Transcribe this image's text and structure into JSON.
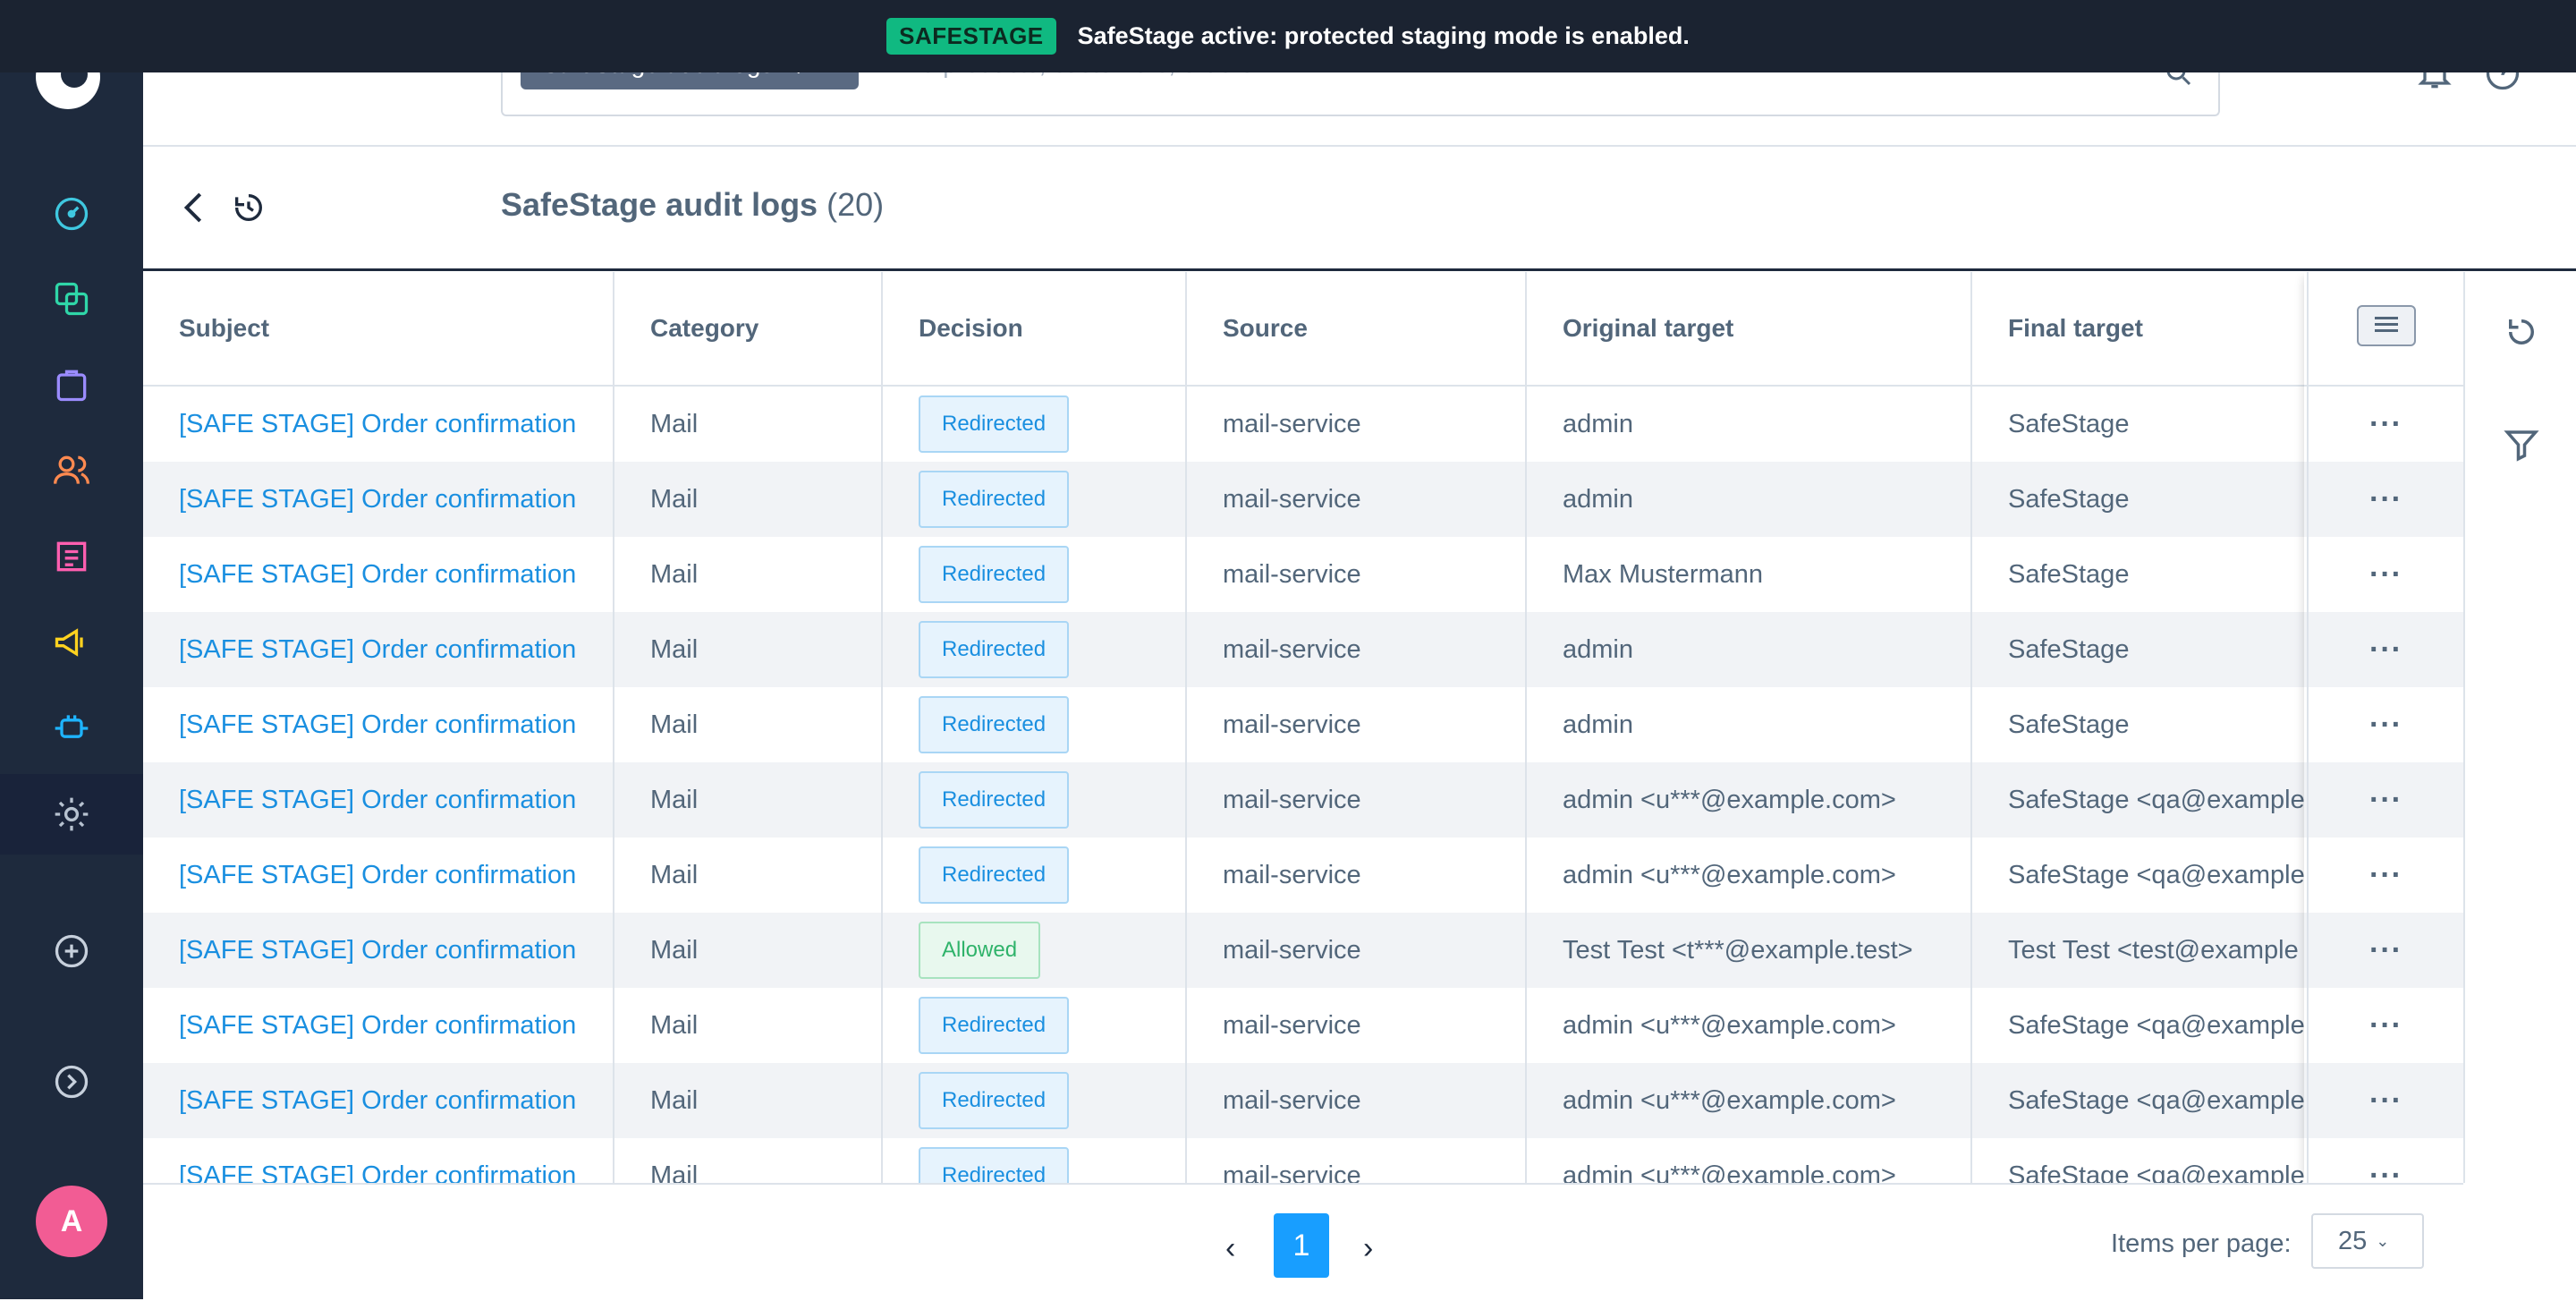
{
  "banner": {
    "badge": "SAFESTAGE",
    "message": "SafeStage active: protected staging mode is enabled."
  },
  "header": {
    "search_type": "SafeStage audit logs",
    "search_placeholder": "Find products, customers, orders..."
  },
  "sidebar": {
    "avatar_initial": "A",
    "icons": [
      "dashboard-icon",
      "catalog-icon",
      "orders-icon",
      "customers-icon",
      "content-icon",
      "marketing-icon",
      "extensions-icon",
      "settings-icon",
      "add-icon",
      "expand-icon"
    ],
    "colors": {
      "dashboard": "#3fc8e0",
      "catalog": "#2fd6a8",
      "orders": "#9b8cff",
      "customers": "#ff8a50",
      "content": "#ff5fb0",
      "marketing": "#ffd21f",
      "extensions": "#1eb4ff",
      "settings": "#b7c2d0"
    }
  },
  "page": {
    "title": "SafeStage audit logs",
    "count": "(20)"
  },
  "table": {
    "columns": [
      "Subject",
      "Category",
      "Decision",
      "Source",
      "Original target",
      "Final target"
    ],
    "rows": [
      {
        "subject": "[SAFE STAGE] Order confirmation",
        "category": "Mail",
        "decision": "Redirected",
        "source": "mail-service",
        "original": "admin",
        "final": "SafeStage"
      },
      {
        "subject": "[SAFE STAGE] Order confirmation",
        "category": "Mail",
        "decision": "Redirected",
        "source": "mail-service",
        "original": "admin",
        "final": "SafeStage"
      },
      {
        "subject": "[SAFE STAGE] Order confirmation",
        "category": "Mail",
        "decision": "Redirected",
        "source": "mail-service",
        "original": "Max Mustermann",
        "final": "SafeStage"
      },
      {
        "subject": "[SAFE STAGE] Order confirmation",
        "category": "Mail",
        "decision": "Redirected",
        "source": "mail-service",
        "original": "admin",
        "final": "SafeStage"
      },
      {
        "subject": "[SAFE STAGE] Order confirmation",
        "category": "Mail",
        "decision": "Redirected",
        "source": "mail-service",
        "original": "admin",
        "final": "SafeStage"
      },
      {
        "subject": "[SAFE STAGE] Order confirmation",
        "category": "Mail",
        "decision": "Redirected",
        "source": "mail-service",
        "original": "admin <u***@example.com>",
        "final": "SafeStage <qa@example"
      },
      {
        "subject": "[SAFE STAGE] Order confirmation",
        "category": "Mail",
        "decision": "Redirected",
        "source": "mail-service",
        "original": "admin <u***@example.com>",
        "final": "SafeStage <qa@example"
      },
      {
        "subject": "[SAFE STAGE] Order confirmation",
        "category": "Mail",
        "decision": "Allowed",
        "source": "mail-service",
        "original": "Test Test <t***@example.test>",
        "final": "Test Test <test@example"
      },
      {
        "subject": "[SAFE STAGE] Order confirmation",
        "category": "Mail",
        "decision": "Redirected",
        "source": "mail-service",
        "original": "admin <u***@example.com>",
        "final": "SafeStage <qa@example"
      },
      {
        "subject": "[SAFE STAGE] Order confirmation",
        "category": "Mail",
        "decision": "Redirected",
        "source": "mail-service",
        "original": "admin <u***@example.com>",
        "final": "SafeStage <qa@example"
      },
      {
        "subject": "[SAFE STAGE] Order confirmation",
        "category": "Mail",
        "decision": "Redirected",
        "source": "mail-service",
        "original": "admin <u***@example.com>",
        "final": "SafeStage <qa@example"
      }
    ],
    "row_action": "···"
  },
  "pagination": {
    "prev": "‹",
    "current_page": "1",
    "next": "›",
    "items_per_page_label": "Items per page:",
    "items_per_page": "25"
  }
}
